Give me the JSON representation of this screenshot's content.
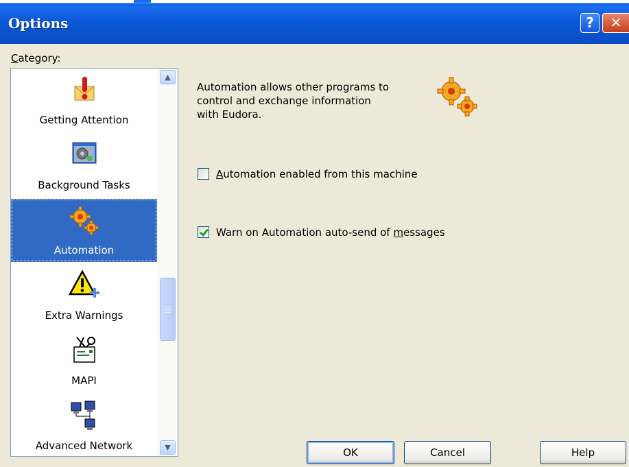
{
  "window": {
    "title": "Options",
    "help_glyph": "?",
    "close_glyph": "✕"
  },
  "category_label": {
    "accel": "C",
    "rest": "ategory:"
  },
  "categories": [
    {
      "label": "Getting Attention",
      "icon": "exclamation-envelope-icon"
    },
    {
      "label": "Background Tasks",
      "icon": "background-tasks-icon"
    },
    {
      "label": "Automation",
      "icon": "gears-icon",
      "selected": true
    },
    {
      "label": "Extra Warnings",
      "icon": "warning-icon"
    },
    {
      "label": "MAPI",
      "icon": "mapi-icon"
    },
    {
      "label": "Advanced Network",
      "icon": "network-computers-icon"
    }
  ],
  "description": {
    "line1": "Automation allows other programs to",
    "line2": "control and exchange information",
    "line3": "with Eudora."
  },
  "options": {
    "automation_enabled": {
      "accel": "A",
      "rest": "utomation enabled from this machine",
      "checked": false
    },
    "warn_autosend": {
      "before": "Warn on Automation auto-send of ",
      "accel": "m",
      "after": "essages",
      "checked": true
    }
  },
  "buttons": {
    "ok": "OK",
    "cancel": "Cancel",
    "help": "Help"
  },
  "colors": {
    "selection": "#316AC5",
    "title_bar": "#0A5CE8",
    "dialog_bg": "#ECE9D8"
  }
}
